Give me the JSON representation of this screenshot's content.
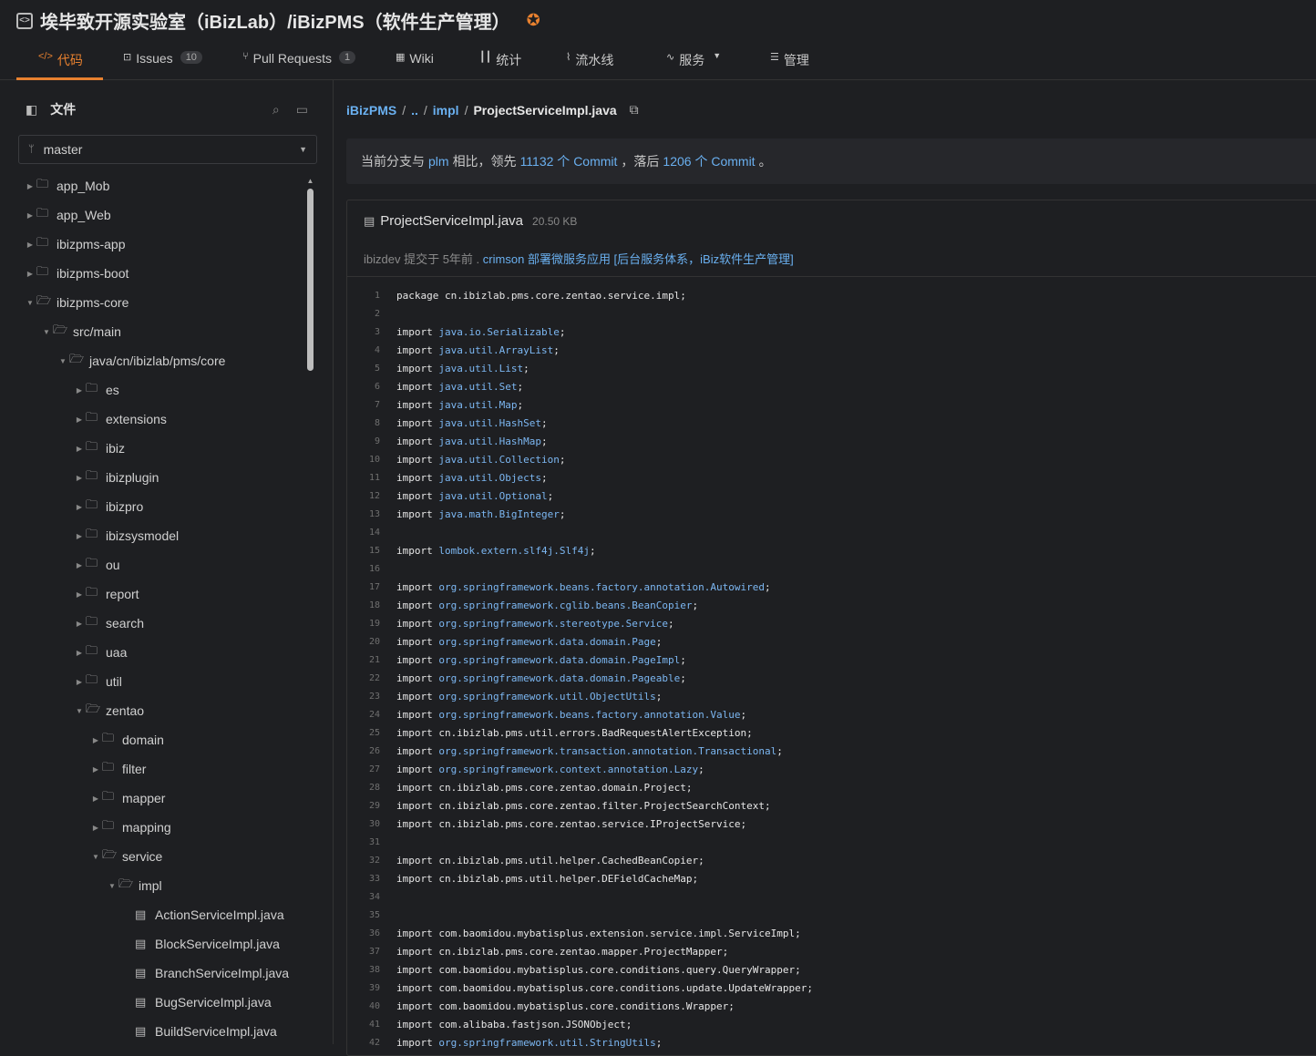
{
  "repo": {
    "title": "埃毕致开源实验室（iBizLab）/iBizPMS（软件生产管理）"
  },
  "tabs": [
    {
      "icon": "code-icon",
      "label": "代码",
      "badge": null
    },
    {
      "icon": "issues-icon",
      "label": "Issues",
      "badge": "10"
    },
    {
      "icon": "pull-request-icon",
      "label": "Pull Requests",
      "badge": "1"
    },
    {
      "icon": "wiki-icon",
      "label": "Wiki",
      "badge": null
    },
    {
      "icon": "stats-icon",
      "label": "统计",
      "badge": null
    },
    {
      "icon": "pipeline-icon",
      "label": "流水线",
      "badge": null
    },
    {
      "icon": "service-icon",
      "label": "服务",
      "badge": null
    },
    {
      "icon": "manage-icon",
      "label": "管理",
      "badge": null
    }
  ],
  "sidebar": {
    "title": "文件",
    "branch": "master",
    "tree": [
      {
        "label": "app_Mob",
        "type": "folder",
        "depth": 0,
        "open": false
      },
      {
        "label": "app_Web",
        "type": "folder",
        "depth": 0,
        "open": false
      },
      {
        "label": "ibizpms-app",
        "type": "folder",
        "depth": 0,
        "open": false
      },
      {
        "label": "ibizpms-boot",
        "type": "folder",
        "depth": 0,
        "open": false
      },
      {
        "label": "ibizpms-core",
        "type": "folder",
        "depth": 0,
        "open": true
      },
      {
        "label": "src/main",
        "type": "folder",
        "depth": 1,
        "open": true
      },
      {
        "label": "java/cn/ibizlab/pms/core",
        "type": "folder",
        "depth": 2,
        "open": true
      },
      {
        "label": "es",
        "type": "folder",
        "depth": 3,
        "open": false
      },
      {
        "label": "extensions",
        "type": "folder",
        "depth": 3,
        "open": false
      },
      {
        "label": "ibiz",
        "type": "folder",
        "depth": 3,
        "open": false
      },
      {
        "label": "ibizplugin",
        "type": "folder",
        "depth": 3,
        "open": false
      },
      {
        "label": "ibizpro",
        "type": "folder",
        "depth": 3,
        "open": false
      },
      {
        "label": "ibizsysmodel",
        "type": "folder",
        "depth": 3,
        "open": false
      },
      {
        "label": "ou",
        "type": "folder",
        "depth": 3,
        "open": false
      },
      {
        "label": "report",
        "type": "folder",
        "depth": 3,
        "open": false
      },
      {
        "label": "search",
        "type": "folder",
        "depth": 3,
        "open": false
      },
      {
        "label": "uaa",
        "type": "folder",
        "depth": 3,
        "open": false
      },
      {
        "label": "util",
        "type": "folder",
        "depth": 3,
        "open": false
      },
      {
        "label": "zentao",
        "type": "folder",
        "depth": 3,
        "open": true
      },
      {
        "label": "domain",
        "type": "folder",
        "depth": 4,
        "open": false
      },
      {
        "label": "filter",
        "type": "folder",
        "depth": 4,
        "open": false
      },
      {
        "label": "mapper",
        "type": "folder",
        "depth": 4,
        "open": false
      },
      {
        "label": "mapping",
        "type": "folder",
        "depth": 4,
        "open": false
      },
      {
        "label": "service",
        "type": "folder",
        "depth": 4,
        "open": true
      },
      {
        "label": "impl",
        "type": "folder",
        "depth": 5,
        "open": true
      },
      {
        "label": "ActionServiceImpl.java",
        "type": "file",
        "depth": 6,
        "open": false
      },
      {
        "label": "BlockServiceImpl.java",
        "type": "file",
        "depth": 6,
        "open": false
      },
      {
        "label": "BranchServiceImpl.java",
        "type": "file",
        "depth": 6,
        "open": false
      },
      {
        "label": "BugServiceImpl.java",
        "type": "file",
        "depth": 6,
        "open": false
      },
      {
        "label": "BuildServiceImpl.java",
        "type": "file",
        "depth": 6,
        "open": false
      }
    ]
  },
  "breadcrumb": {
    "root": "iBizPMS",
    "sep": "/",
    "up": "..",
    "folder": "impl",
    "file": "ProjectServiceImpl.java"
  },
  "compare": {
    "prefix": "当前分支与",
    "branch": "plm",
    "mid1": "相比，领先",
    "ahead": "11132 个 Commit",
    "mid2": "，落后",
    "behind": "1206 个 Commit",
    "suffix": "。"
  },
  "file": {
    "name": "ProjectServiceImpl.java",
    "size": "20.50 KB",
    "commit_author": "ibizdev",
    "commit_meta": "提交于 5年前 .",
    "commit_branch": "crimson",
    "commit_msg": "部署微服务应用 [后台服务体系，iBiz软件生产管理]"
  },
  "code": [
    {
      "n": "1",
      "kw": "package",
      "pkg": "cn.ibizlab.pms.core.zentao.service.impl",
      "tail": ";",
      "blue": false
    },
    {
      "n": "2",
      "kw": "",
      "pkg": "",
      "tail": "",
      "blue": false
    },
    {
      "n": "3",
      "kw": "import",
      "pkg": "java.io.Serializable",
      "tail": ";",
      "blue": true
    },
    {
      "n": "4",
      "kw": "import",
      "pkg": "java.util.ArrayList",
      "tail": ";",
      "blue": true
    },
    {
      "n": "5",
      "kw": "import",
      "pkg": "java.util.List",
      "tail": ";",
      "blue": true
    },
    {
      "n": "6",
      "kw": "import",
      "pkg": "java.util.Set",
      "tail": ";",
      "blue": true
    },
    {
      "n": "7",
      "kw": "import",
      "pkg": "java.util.Map",
      "tail": ";",
      "blue": true
    },
    {
      "n": "8",
      "kw": "import",
      "pkg": "java.util.HashSet",
      "tail": ";",
      "blue": true
    },
    {
      "n": "9",
      "kw": "import",
      "pkg": "java.util.HashMap",
      "tail": ";",
      "blue": true
    },
    {
      "n": "10",
      "kw": "import",
      "pkg": "java.util.Collection",
      "tail": ";",
      "blue": true
    },
    {
      "n": "11",
      "kw": "import",
      "pkg": "java.util.Objects",
      "tail": ";",
      "blue": true
    },
    {
      "n": "12",
      "kw": "import",
      "pkg": "java.util.Optional",
      "tail": ";",
      "blue": true
    },
    {
      "n": "13",
      "kw": "import",
      "pkg": "java.math.BigInteger",
      "tail": ";",
      "blue": true
    },
    {
      "n": "14",
      "kw": "",
      "pkg": "",
      "tail": "",
      "blue": false
    },
    {
      "n": "15",
      "kw": "import",
      "pkg": "lombok.extern.slf4j.Slf4j",
      "tail": ";",
      "blue": true
    },
    {
      "n": "16",
      "kw": "",
      "pkg": "",
      "tail": "",
      "blue": false
    },
    {
      "n": "17",
      "kw": "import",
      "pkg": "org.springframework.beans.factory.annotation.Autowired",
      "tail": ";",
      "blue": true
    },
    {
      "n": "18",
      "kw": "import",
      "pkg": "org.springframework.cglib.beans.BeanCopier",
      "tail": ";",
      "blue": true
    },
    {
      "n": "19",
      "kw": "import",
      "pkg": "org.springframework.stereotype.Service",
      "tail": ";",
      "blue": true
    },
    {
      "n": "20",
      "kw": "import",
      "pkg": "org.springframework.data.domain.Page",
      "tail": ";",
      "blue": true
    },
    {
      "n": "21",
      "kw": "import",
      "pkg": "org.springframework.data.domain.PageImpl",
      "tail": ";",
      "blue": true
    },
    {
      "n": "22",
      "kw": "import",
      "pkg": "org.springframework.data.domain.Pageable",
      "tail": ";",
      "blue": true
    },
    {
      "n": "23",
      "kw": "import",
      "pkg": "org.springframework.util.ObjectUtils",
      "tail": ";",
      "blue": true
    },
    {
      "n": "24",
      "kw": "import",
      "pkg": "org.springframework.beans.factory.annotation.Value",
      "tail": ";",
      "blue": true
    },
    {
      "n": "25",
      "kw": "import",
      "pkg": "cn.ibizlab.pms.util.errors.BadRequestAlertException",
      "tail": ";",
      "blue": false
    },
    {
      "n": "26",
      "kw": "import",
      "pkg": "org.springframework.transaction.annotation.Transactional",
      "tail": ";",
      "blue": true
    },
    {
      "n": "27",
      "kw": "import",
      "pkg": "org.springframework.context.annotation.Lazy",
      "tail": ";",
      "blue": true
    },
    {
      "n": "28",
      "kw": "import",
      "pkg": "cn.ibizlab.pms.core.zentao.domain.Project",
      "tail": ";",
      "blue": false
    },
    {
      "n": "29",
      "kw": "import",
      "pkg": "cn.ibizlab.pms.core.zentao.filter.ProjectSearchContext",
      "tail": ";",
      "blue": false
    },
    {
      "n": "30",
      "kw": "import",
      "pkg": "cn.ibizlab.pms.core.zentao.service.IProjectService",
      "tail": ";",
      "blue": false
    },
    {
      "n": "31",
      "kw": "",
      "pkg": "",
      "tail": "",
      "blue": false
    },
    {
      "n": "32",
      "kw": "import",
      "pkg": "cn.ibizlab.pms.util.helper.CachedBeanCopier",
      "tail": ";",
      "blue": false
    },
    {
      "n": "33",
      "kw": "import",
      "pkg": "cn.ibizlab.pms.util.helper.DEFieldCacheMap",
      "tail": ";",
      "blue": false
    },
    {
      "n": "34",
      "kw": "",
      "pkg": "",
      "tail": "",
      "blue": false
    },
    {
      "n": "35",
      "kw": "",
      "pkg": "",
      "tail": "",
      "blue": false
    },
    {
      "n": "36",
      "kw": "import",
      "pkg": "com.baomidou.mybatisplus.extension.service.impl.ServiceImpl",
      "tail": ";",
      "blue": false
    },
    {
      "n": "37",
      "kw": "import",
      "pkg": "cn.ibizlab.pms.core.zentao.mapper.ProjectMapper",
      "tail": ";",
      "blue": false
    },
    {
      "n": "38",
      "kw": "import",
      "pkg": "com.baomidou.mybatisplus.core.conditions.query.QueryWrapper",
      "tail": ";",
      "blue": false
    },
    {
      "n": "39",
      "kw": "import",
      "pkg": "com.baomidou.mybatisplus.core.conditions.update.UpdateWrapper",
      "tail": ";",
      "blue": false
    },
    {
      "n": "40",
      "kw": "import",
      "pkg": "com.baomidou.mybatisplus.core.conditions.Wrapper",
      "tail": ";",
      "blue": false
    },
    {
      "n": "41",
      "kw": "import",
      "pkg": "com.alibaba.fastjson.JSONObject",
      "tail": ";",
      "blue": false
    },
    {
      "n": "42",
      "kw": "import",
      "pkg": "org.springframework.util.StringUtils",
      "tail": ";",
      "blue": true
    }
  ]
}
